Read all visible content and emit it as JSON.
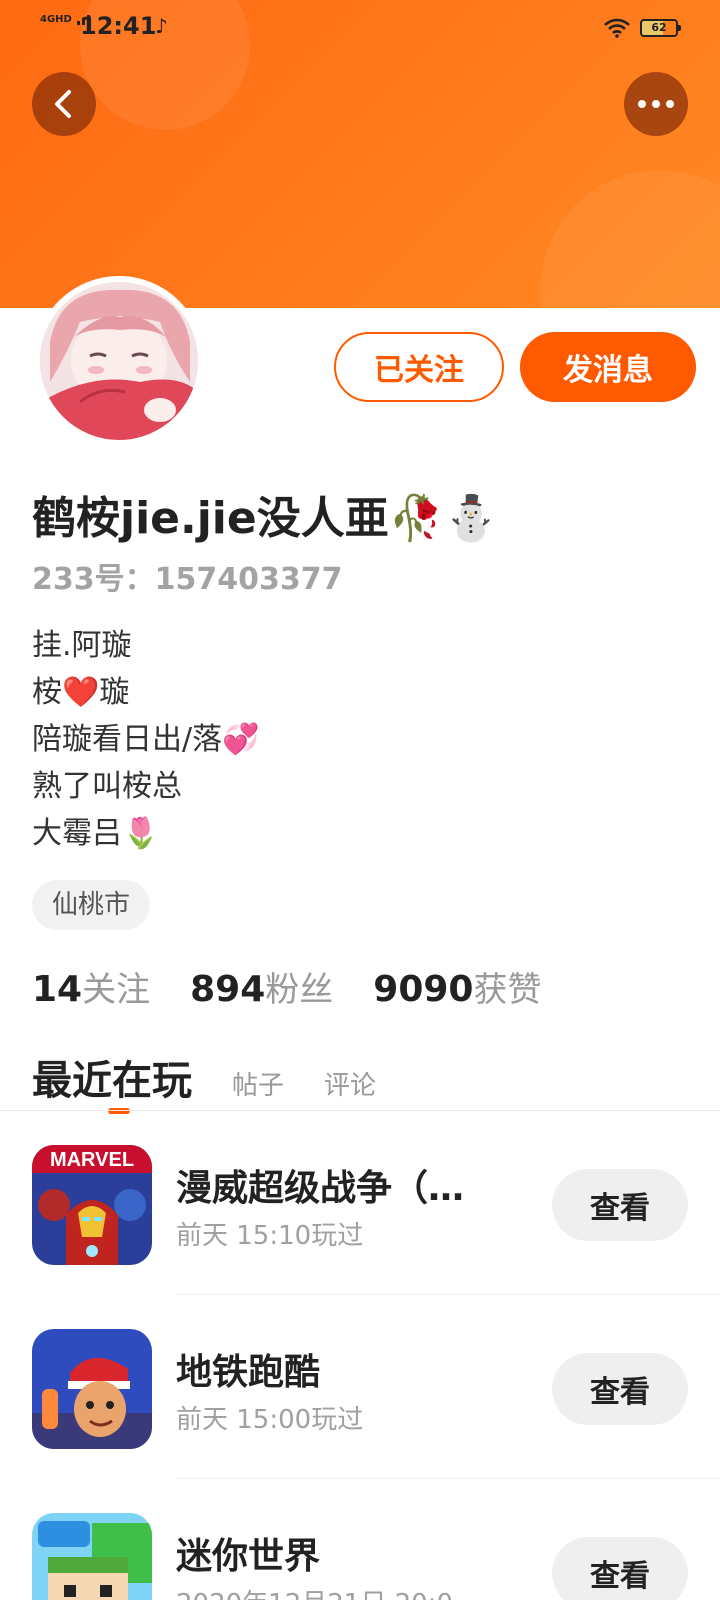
{
  "status_bar": {
    "network": "4GHD",
    "time": "12:41",
    "battery": "62"
  },
  "profile": {
    "follow_button": "已关注",
    "message_button": "发消息",
    "name": "鹤桉jie.jie没人亜🥀⛄",
    "uid": "233号：157403377",
    "bio_lines": [
      "挂.阿璇",
      "桉❤️璇",
      "陪璇看日出/落💞",
      "熟了叫桉总",
      "大霉吕🌷"
    ],
    "location": "仙桃市",
    "stats": [
      {
        "number": "14",
        "label": "关注"
      },
      {
        "number": "894",
        "label": "粉丝"
      },
      {
        "number": "9090",
        "label": "获赞"
      }
    ]
  },
  "tabs": [
    "最近在玩",
    "帖子",
    "评论"
  ],
  "games": [
    {
      "title": "漫威超级战争（…",
      "time": "前天 15:10玩过",
      "button": "查看",
      "icon": "marvel-game-icon"
    },
    {
      "title": "地铁跑酷",
      "time": "前天 15:00玩过",
      "button": "查看",
      "icon": "subway-surfers-icon"
    },
    {
      "title": "迷你世界",
      "time": "2020年12月21日 20:0",
      "button": "查看",
      "icon": "mini-world-icon"
    }
  ],
  "colors": {
    "accent": "#ff5a00",
    "banner": "#ff7a1c"
  }
}
